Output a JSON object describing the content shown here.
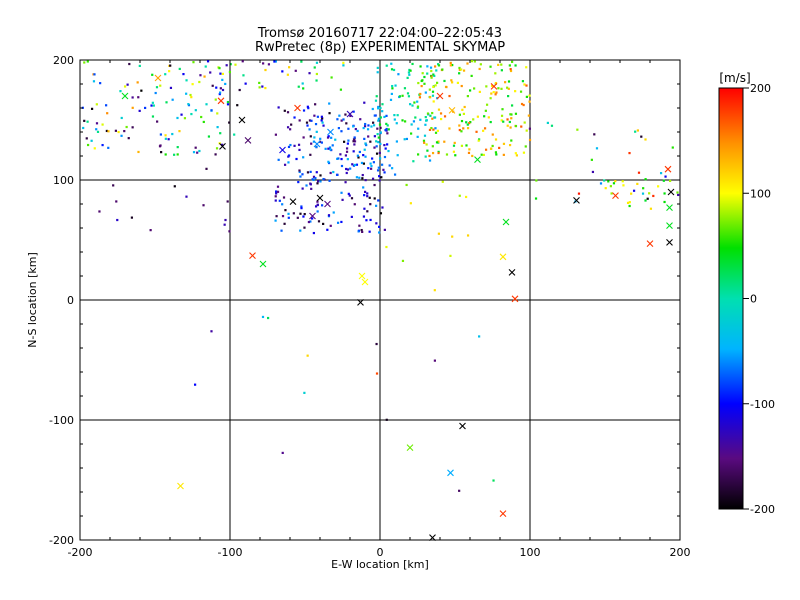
{
  "chart_data": {
    "type": "scatter",
    "title": "Tromsø 20160717 22:04:00–22:05:43",
    "subtitle": "RwPretec (8p) EXPERIMENTAL SKYMAP",
    "xlabel": "E-W location [km]",
    "ylabel": "N-S location [km]",
    "xlim": [
      -200,
      200
    ],
    "ylim": [
      -200,
      200
    ],
    "x_ticks": [
      "-200",
      "-100",
      "0",
      "100",
      "200"
    ],
    "y_ticks": [
      "-200",
      "-100",
      "0",
      "100",
      "200"
    ],
    "grid": true,
    "colorbar": {
      "label": "[m/s]",
      "range": [
        -200,
        200
      ],
      "ticks": [
        "-200",
        "-100",
        "0",
        "100",
        "200"
      ],
      "colormap": "rainbow (black → purple → blue → cyan → green → yellow → orange → red)"
    },
    "marker_types": [
      "dot",
      "x"
    ],
    "cluster_summary": [
      {
        "region": "x −60…0, y 60…160",
        "velocity_m_s": "-150 to -80 (blue/purple)"
      },
      {
        "region": "x 30…90, y 130…190",
        "velocity_m_s": "60 to 160 (orange/yellow/red)"
      },
      {
        "region": "x −200…−100, y 130…200",
        "velocity_m_s": "mixed -200 to 150"
      }
    ],
    "x_markers": [
      {
        "x": -133,
        "y": -155,
        "v": 110
      },
      {
        "x": 20,
        "y": -123,
        "v": 70
      },
      {
        "x": 47,
        "y": -144,
        "v": -50
      },
      {
        "x": 55,
        "y": -105,
        "v": -200
      },
      {
        "x": 82,
        "y": -178,
        "v": 180
      },
      {
        "x": 35,
        "y": -198,
        "v": -200
      },
      {
        "x": -13,
        "y": -2,
        "v": -200
      },
      {
        "x": 90,
        "y": 1,
        "v": 180
      },
      {
        "x": 88,
        "y": 23,
        "v": -200
      },
      {
        "x": 82,
        "y": 36,
        "v": 110
      },
      {
        "x": 84,
        "y": 65,
        "v": 40
      },
      {
        "x": -10,
        "y": 15,
        "v": 100
      },
      {
        "x": -12,
        "y": 20,
        "v": 100
      },
      {
        "x": -85,
        "y": 37,
        "v": 180
      },
      {
        "x": -78,
        "y": 30,
        "v": 40
      },
      {
        "x": 131,
        "y": 83,
        "v": -200
      },
      {
        "x": 157,
        "y": 87,
        "v": 180
      },
      {
        "x": 180,
        "y": 47,
        "v": 180
      },
      {
        "x": 193,
        "y": 48,
        "v": -200
      },
      {
        "x": 193,
        "y": 62,
        "v": 40
      },
      {
        "x": 193,
        "y": 77,
        "v": 40
      },
      {
        "x": 194,
        "y": 90,
        "v": -200
      },
      {
        "x": 192,
        "y": 109,
        "v": 180
      },
      {
        "x": 65,
        "y": 117,
        "v": 40
      },
      {
        "x": 40,
        "y": 170,
        "v": 180
      },
      {
        "x": 76,
        "y": 178,
        "v": 180
      },
      {
        "x": 48,
        "y": 158,
        "v": 130
      },
      {
        "x": -40,
        "y": 85,
        "v": -200
      },
      {
        "x": -35,
        "y": 80,
        "v": -150
      },
      {
        "x": -45,
        "y": 70,
        "v": -150
      },
      {
        "x": -58,
        "y": 82,
        "v": -200
      },
      {
        "x": -33,
        "y": 140,
        "v": -60
      },
      {
        "x": -42,
        "y": 130,
        "v": -60
      },
      {
        "x": -20,
        "y": 155,
        "v": -130
      },
      {
        "x": -65,
        "y": 125,
        "v": -110
      },
      {
        "x": -88,
        "y": 133,
        "v": -160
      },
      {
        "x": -92,
        "y": 150,
        "v": -200
      },
      {
        "x": -105,
        "y": 128,
        "v": -200
      },
      {
        "x": -106,
        "y": 166,
        "v": 180
      },
      {
        "x": -55,
        "y": 160,
        "v": 180
      },
      {
        "x": -148,
        "y": 185,
        "v": 140
      },
      {
        "x": -170,
        "y": 170,
        "v": 40
      }
    ],
    "dot_groups": [
      {
        "name": "west-cluster",
        "n": 230,
        "x": [
          -70,
          5
        ],
        "y": [
          55,
          165
        ],
        "v": [
          -200,
          -50
        ]
      },
      {
        "name": "west-cluster-cyan",
        "n": 60,
        "x": [
          -45,
          15
        ],
        "y": [
          100,
          160
        ],
        "v": [
          -80,
          -30
        ]
      },
      {
        "name": "mid-upper",
        "n": 90,
        "x": [
          -5,
          40
        ],
        "y": [
          115,
          200
        ],
        "v": [
          -60,
          60
        ]
      },
      {
        "name": "east-cluster",
        "n": 190,
        "x": [
          25,
          100
        ],
        "y": [
          120,
          200
        ],
        "v": [
          30,
          170
        ]
      },
      {
        "name": "northwest",
        "n": 130,
        "x": [
          -200,
          -95
        ],
        "y": [
          120,
          200
        ],
        "v": [
          -200,
          150
        ]
      },
      {
        "name": "north-strip",
        "n": 40,
        "x": [
          -110,
          -20
        ],
        "y": [
          175,
          200
        ],
        "v": [
          -200,
          120
        ]
      },
      {
        "name": "east-fringe",
        "n": 30,
        "x": [
          95,
          200
        ],
        "y": [
          80,
          150
        ],
        "v": [
          -200,
          200
        ]
      },
      {
        "name": "east-right",
        "n": 22,
        "x": [
          150,
          200
        ],
        "y": [
          75,
          100
        ],
        "v": [
          40,
          120
        ]
      },
      {
        "name": "scattered-west",
        "n": 14,
        "x": [
          -200,
          -100
        ],
        "y": [
          50,
          115
        ],
        "v": [
          -200,
          -120
        ]
      },
      {
        "name": "mid-right-scatter",
        "n": 12,
        "x": [
          0,
          60
        ],
        "y": [
          8,
          100
        ],
        "v": [
          60,
          120
        ]
      },
      {
        "name": "south-scatter",
        "n": 14,
        "x": [
          -145,
          100
        ],
        "y": [
          -180,
          -10
        ],
        "v": [
          -200,
          200
        ]
      }
    ]
  }
}
